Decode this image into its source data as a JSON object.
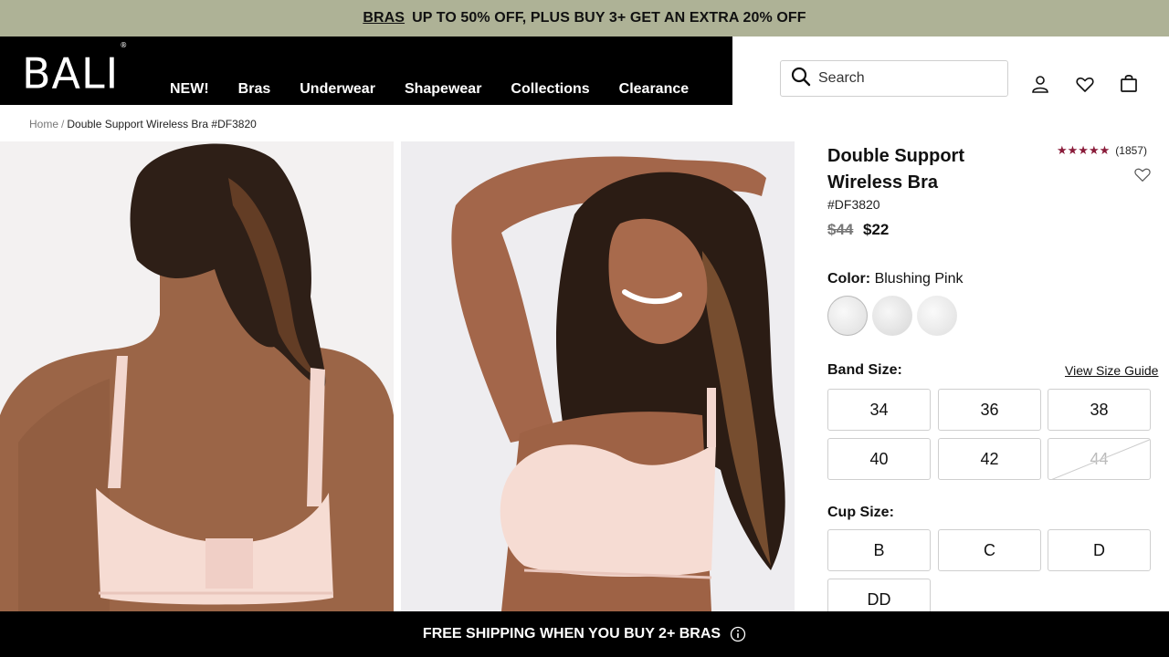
{
  "promo": {
    "link_label": "BRAS",
    "text": "UP TO 50% OFF, PLUS BUY 3+ GET AN EXTRA 20% OFF",
    "background": "#aeb296"
  },
  "header": {
    "logo_text": "BALI",
    "logo_mark": "®",
    "nav": [
      "NEW!",
      "Bras",
      "Underwear",
      "Shapewear",
      "Collections",
      "Clearance"
    ],
    "search_placeholder": "Search",
    "icons": [
      "search-icon",
      "account-icon",
      "heart-icon",
      "bag-icon"
    ]
  },
  "breadcrumb": {
    "home": "Home",
    "separator": "/",
    "current": "Double Support Wireless Bra #DF3820"
  },
  "product": {
    "title": "Double Support Wireless Bra",
    "rating_stars": "★★★★★",
    "rating_value": 4.5,
    "rating_count": "(1857)",
    "sku": "#DF3820",
    "price_original": "$44",
    "price_sale": "$22",
    "color_label": "Color:",
    "color_value": "Blushing Pink",
    "band_label": "Band Size:",
    "size_guide": "View Size Guide",
    "band_sizes": [
      {
        "label": "34",
        "available": true
      },
      {
        "label": "36",
        "available": true
      },
      {
        "label": "38",
        "available": true
      },
      {
        "label": "40",
        "available": true
      },
      {
        "label": "42",
        "available": true
      },
      {
        "label": "44",
        "available": false
      }
    ],
    "cup_label": "Cup Size:",
    "cup_sizes": [
      "B",
      "C",
      "D",
      "DD"
    ],
    "accent_color": "#8a1c3a"
  },
  "bottom_bar": {
    "text": "FREE SHIPPING WHEN YOU BUY 2+ BRAS",
    "icon": "info-icon"
  }
}
